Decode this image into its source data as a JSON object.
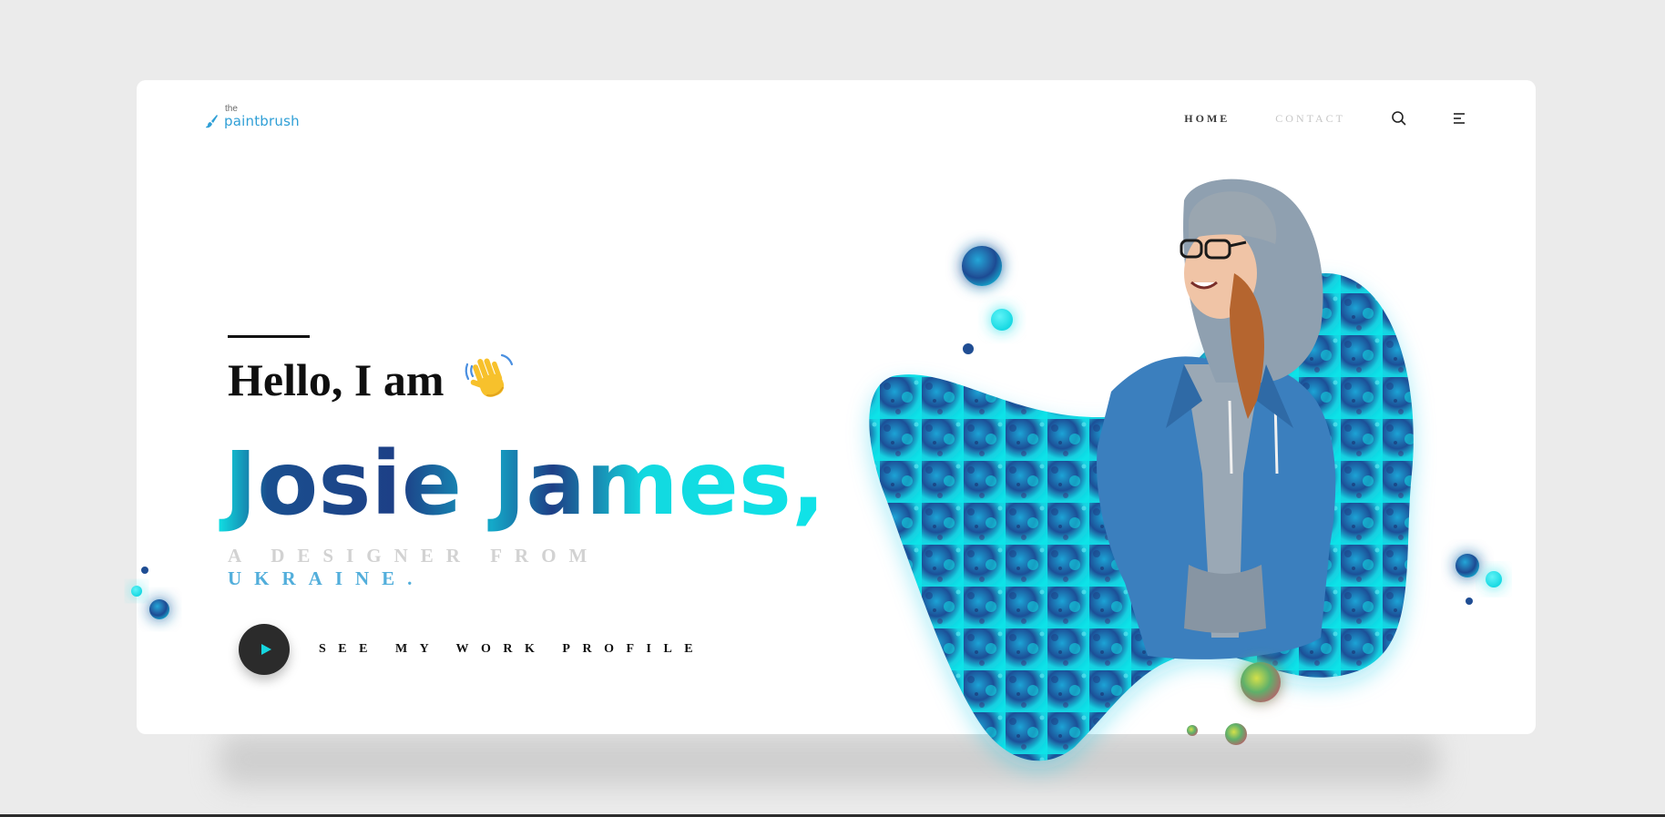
{
  "brand": {
    "the": "the",
    "name": "paintbrush",
    "icon": "paintbrush-icon",
    "color": "#2f9fd6"
  },
  "nav": {
    "items": [
      {
        "label": "HOME",
        "active": true
      },
      {
        "label": "CONTACT",
        "active": false
      }
    ],
    "search_icon": "search-icon",
    "menu_icon": "menu-icon"
  },
  "hero": {
    "greeting": "Hello, I am",
    "wave_icon": "waving-hand-icon",
    "name": "Josie James,",
    "tagline_line1": "A DESIGNER FROM",
    "tagline_line2": "UKRAINE.",
    "cta_label": "SEE MY WORK PROFILE",
    "play_icon": "play-icon"
  },
  "colors": {
    "accent_cyan": "#10e0e6",
    "accent_deep_blue": "#1c3f8a",
    "tagline_blue": "#52aedb",
    "tagline_grey": "#d2d2d2",
    "play_button": "#2b2b2b"
  }
}
